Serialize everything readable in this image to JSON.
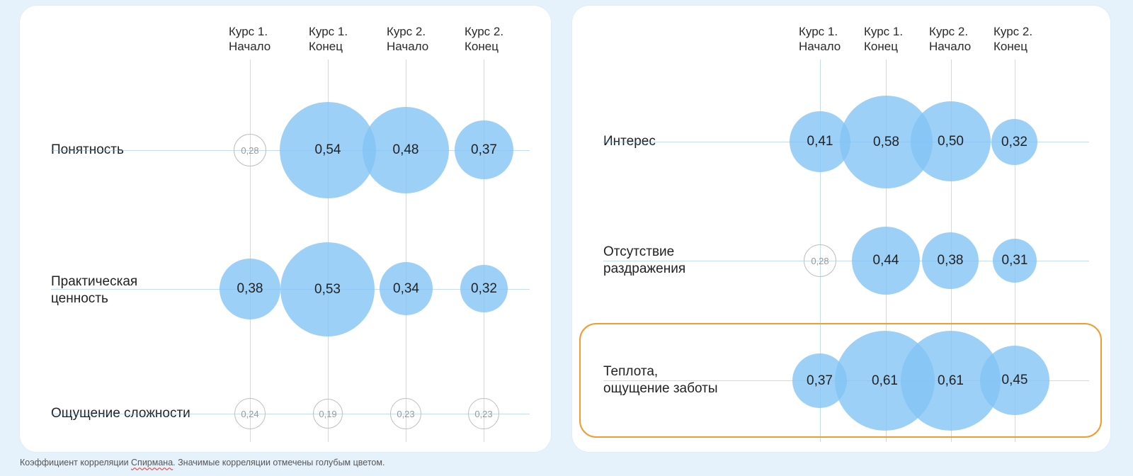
{
  "columns": [
    "Курс 1.\nНачало",
    "Курс 1.\nКонец",
    "Курс 2.\nНачало",
    "Курс 2.\nКонец"
  ],
  "caption_parts": {
    "a": "Коэффициент корреляции ",
    "word": "Спирмана",
    "b": ". Значимые корреляции отмечены голубым цветом."
  },
  "chart_data": [
    {
      "type": "bubble",
      "panel": "left",
      "rows": [
        {
          "label": "Понятность",
          "values": [
            {
              "v": "0,28",
              "n": 0.28,
              "significant": false
            },
            {
              "v": "0,54",
              "n": 0.54,
              "significant": true
            },
            {
              "v": "0,48",
              "n": 0.48,
              "significant": true
            },
            {
              "v": "0,37",
              "n": 0.37,
              "significant": true
            }
          ]
        },
        {
          "label": "Практическая\nценность",
          "values": [
            {
              "v": "0,38",
              "n": 0.38,
              "significant": true
            },
            {
              "v": "0,53",
              "n": 0.53,
              "significant": true
            },
            {
              "v": "0,34",
              "n": 0.34,
              "significant": true
            },
            {
              "v": "0,32",
              "n": 0.32,
              "significant": true
            }
          ]
        },
        {
          "label": "Ощущение сложности",
          "values": [
            {
              "v": "0,24",
              "n": 0.24,
              "significant": false
            },
            {
              "v": "0,19",
              "n": 0.19,
              "significant": false
            },
            {
              "v": "0,23",
              "n": 0.23,
              "significant": false
            },
            {
              "v": "0,23",
              "n": 0.23,
              "significant": false
            }
          ]
        }
      ]
    },
    {
      "type": "bubble",
      "panel": "right",
      "highlight_row_index": 2,
      "rows": [
        {
          "label": "Интерес",
          "values": [
            {
              "v": "0,41",
              "n": 0.41,
              "significant": true
            },
            {
              "v": "0,58",
              "n": 0.58,
              "significant": true
            },
            {
              "v": "0,50",
              "n": 0.5,
              "significant": true
            },
            {
              "v": "0,32",
              "n": 0.32,
              "significant": true
            }
          ]
        },
        {
          "label": "Отсутствие\nраздражения",
          "values": [
            {
              "v": "0,28",
              "n": 0.28,
              "significant": false
            },
            {
              "v": "0,44",
              "n": 0.44,
              "significant": true
            },
            {
              "v": "0,38",
              "n": 0.38,
              "significant": true
            },
            {
              "v": "0,31",
              "n": 0.31,
              "significant": true
            }
          ]
        },
        {
          "label": "Теплота,\nощущение заботы",
          "values": [
            {
              "v": "0,37",
              "n": 0.37,
              "significant": true
            },
            {
              "v": "0,61",
              "n": 0.61,
              "significant": true
            },
            {
              "v": "0,61",
              "n": 0.61,
              "significant": true
            },
            {
              "v": "0,45",
              "n": 0.45,
              "significant": true
            }
          ]
        }
      ]
    }
  ]
}
